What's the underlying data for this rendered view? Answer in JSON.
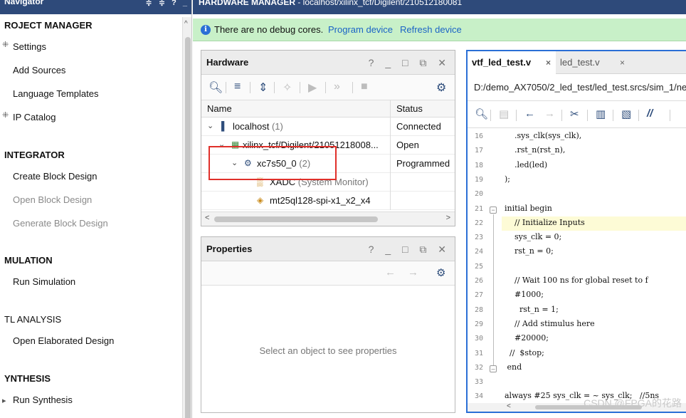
{
  "navigator": {
    "title": "Navigator",
    "controls": "≑ ≑ ? _",
    "sections": [
      {
        "label": "ROJECT MANAGER"
      },
      {
        "label": "INTEGRATOR"
      },
      {
        "label": "MULATION"
      },
      {
        "label": "TL ANALYSIS"
      },
      {
        "label": "YNTHESIS"
      }
    ],
    "items": [
      {
        "label": "Settings"
      },
      {
        "label": "Add Sources"
      },
      {
        "label": "Language Templates"
      },
      {
        "label": "IP Catalog"
      },
      {
        "label": "Create Block Design"
      },
      {
        "label": "Open Block Design"
      },
      {
        "label": "Generate Block Design"
      },
      {
        "label": "Run Simulation"
      },
      {
        "label": "Open Elaborated Design"
      },
      {
        "label": "Run Synthesis"
      }
    ]
  },
  "hardware_manager": {
    "title_bold": "HARDWARE MANAGER",
    "title_rest": " - localhost/xilinx_tcf/Digilent/210512180081"
  },
  "debug_bar": {
    "message": "There are no debug cores.",
    "program_link": "Program device",
    "refresh_link": "Refresh device"
  },
  "hardware_panel": {
    "title": "Hardware",
    "controls": "? _ □ ⧉ ✕",
    "columns": [
      "Name",
      "Status"
    ],
    "rows": [
      {
        "name": "localhost",
        "count": "(1)",
        "status": "Connected"
      },
      {
        "name": "xilinx_tcf/Digilent/21051218008...",
        "count": "",
        "status": "Open"
      },
      {
        "name": "xc7s50_0",
        "count": "(2)",
        "status": "Programmed"
      },
      {
        "name": "XADC",
        "count": "(System Monitor)",
        "status": ""
      },
      {
        "name": "mt25ql128-spi-x1_x2_x4",
        "count": "",
        "status": ""
      }
    ]
  },
  "properties_panel": {
    "title": "Properties",
    "controls": "? _ □ ⧉ ✕",
    "empty_text": "Select an object to see properties"
  },
  "editor": {
    "tabs": [
      {
        "label": "vtf_led_test.v",
        "close": "×"
      },
      {
        "label": "led_test.v",
        "close": "×"
      }
    ],
    "path": "D:/demo_AX7050/2_led_test/led_test.srcs/sim_1/ne",
    "lines": [
      {
        "num": "16",
        "text": "    .sys_clk(sys_clk),"
      },
      {
        "num": "17",
        "text": "    .rst_n(rst_n),"
      },
      {
        "num": "18",
        "text": "    .led(led)"
      },
      {
        "num": "19",
        "text": ");"
      },
      {
        "num": "20",
        "text": ""
      },
      {
        "num": "21",
        "text": "initial begin"
      },
      {
        "num": "22",
        "text": "    // Initialize Inputs"
      },
      {
        "num": "23",
        "text": "    sys_clk = 0;"
      },
      {
        "num": "24",
        "text": "    rst_n = 0;"
      },
      {
        "num": "25",
        "text": ""
      },
      {
        "num": "26",
        "text": "    // Wait 100 ns for global reset to f"
      },
      {
        "num": "27",
        "text": "    #1000;"
      },
      {
        "num": "28",
        "text": "      rst_n = 1;"
      },
      {
        "num": "29",
        "text": "    // Add stimulus here"
      },
      {
        "num": "30",
        "text": "    #20000;"
      },
      {
        "num": "31",
        "text": "  //  $stop;"
      },
      {
        "num": "32",
        "text": " end"
      },
      {
        "num": "33",
        "text": ""
      },
      {
        "num": "34",
        "text": "always #25 sys_clk = ~ sys_clk;   //5ns"
      }
    ]
  },
  "watermark": "CSDN @FPGA的花路",
  "colors": {
    "title_bar": "#2e4a7a",
    "debug_bar": "#c8f0c8",
    "link": "#1a63c6",
    "selection_box": "#e0302a",
    "editor_border": "#2a6fd6"
  }
}
